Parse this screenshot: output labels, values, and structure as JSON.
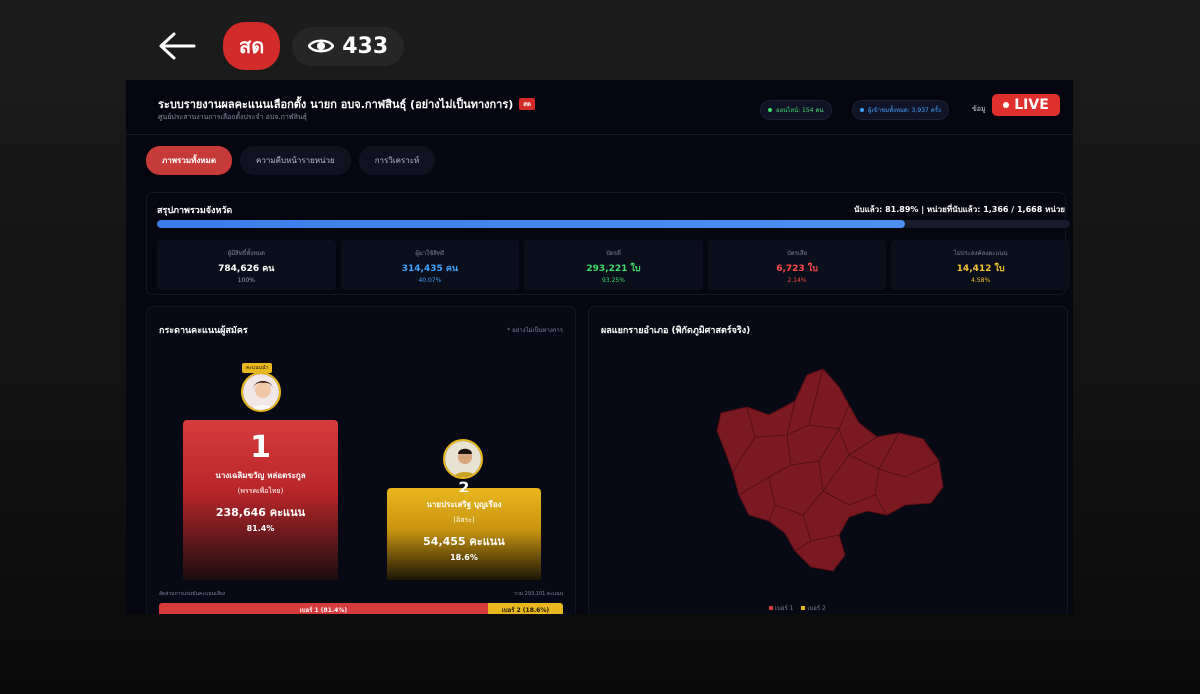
{
  "overlay": {
    "live_label": "สด",
    "viewer_count": "433"
  },
  "dashboard": {
    "title": "ระบบรายงานผลคะแนนเลือกตั้ง นายก อบจ.กาฬสินธุ์ (อย่างไม่เป็นทางการ)",
    "title_tag": "สด",
    "subtitle": "ศูนย์ประสานงานการเลือกตั้งประจำ อบจ.กาฬสินธุ์",
    "online_chip": "ออนไลน์: 154 คน",
    "visitors_chip": "ผู้เข้าชมทั้งหมด: 3,937 ครั้ง",
    "data_label": "ข้อมู",
    "live_badge": "LIVE",
    "tabs": [
      "ภาพรวมทั้งหมด",
      "ความคืบหน้ารายหน่วย",
      "การวิเคราะห์"
    ],
    "summary": {
      "title": "สรุปภาพรวมจังหวัด",
      "counted_text": "นับแล้ว: 81.89% | หน่วยที่นับแล้ว: 1,366 / 1,668 หน่วย",
      "progress_fraction": 0.8189,
      "stats": [
        {
          "label": "ผู้มีสิทธิ์ทั้งหมด",
          "value": "784,626 คน",
          "pct": "100%",
          "color": "#ffffff"
        },
        {
          "label": "ผู้มาใช้สิทธิ",
          "value": "314,435 คน",
          "pct": "40.07%",
          "color": "#3fa3ff"
        },
        {
          "label": "บัตรดี",
          "value": "293,221 ใบ",
          "pct": "93.25%",
          "color": "#3fdc6b"
        },
        {
          "label": "บัตรเสีย",
          "value": "6,723 ใบ",
          "pct": "2.14%",
          "color": "#ff4a4a"
        },
        {
          "label": "ไม่ประสงค์ลงคะแนน",
          "value": "14,412 ใบ",
          "pct": "4.58%",
          "color": "#f2c12e"
        }
      ]
    },
    "candidates_panel": {
      "title": "กระดานคะแนนผู้สมัคร",
      "note": "* อย่างไม่เป็นทางการ",
      "leader_tag": "คะแนนนำ",
      "candidates": [
        {
          "rank": "1",
          "name": "นางเฉลิมขวัญ หล่อตระกูล",
          "party": "(พรรคเพื่อไทย)",
          "votes": "238,646 คะแนน",
          "pct": "81.4%",
          "share": 0.814
        },
        {
          "rank": "2",
          "name": "นายประเสริฐ บุญเรือง",
          "party": "(อิสระ)",
          "votes": "54,455 คะแนน",
          "pct": "18.6%",
          "share": 0.186
        }
      ],
      "share_label": "สัดส่วนการแข่งขันคะแนนเสียง",
      "share_total": "รวม 293,101 คะแนน",
      "share_a_label": "เบอร์ 1 (81.4%)",
      "share_b_label": "เบอร์ 2 (18.6%)"
    },
    "map_panel": {
      "title": "ผลแยกรายอำเภอ (พิกัดภูมิศาสตร์จริง)",
      "legend": [
        "เบอร์ 1",
        "เบอร์ 2"
      ],
      "colors": {
        "no1": "#7a1a20",
        "no2": "#e9b81f"
      }
    }
  }
}
